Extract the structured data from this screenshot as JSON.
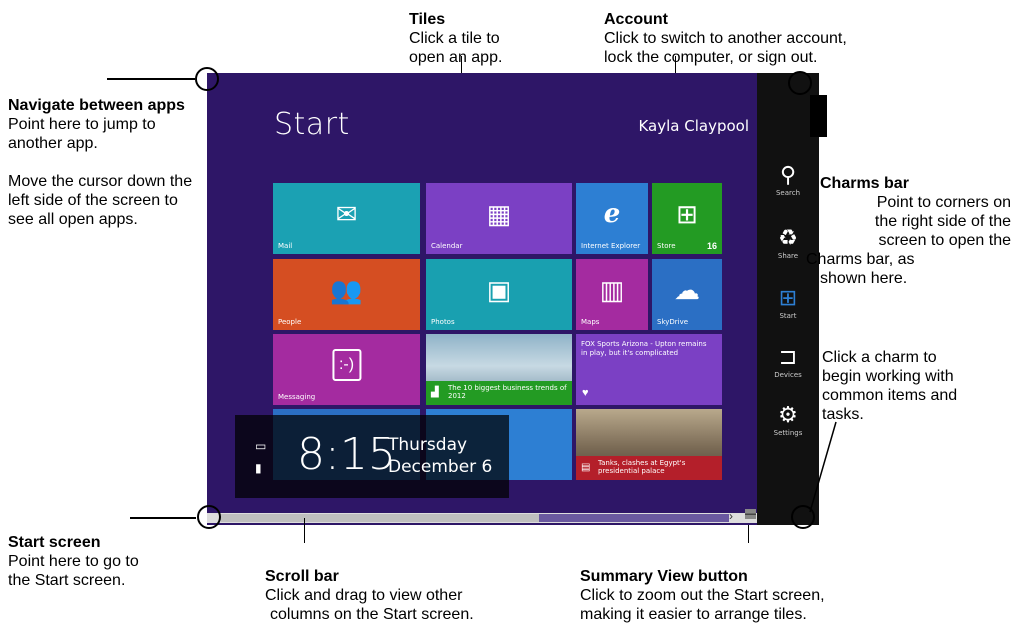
{
  "callouts": {
    "navigate": {
      "bold": "Navigate between apps",
      "text": "Point here to jump to another app.",
      "extra": "Move the cursor down the left side of the screen to see all open apps."
    },
    "tiles": {
      "title": "Tiles",
      "text1": "Click a tile to",
      "text2": "open an app."
    },
    "account": {
      "title": "Account",
      "text1": "Click to switch to another account,",
      "text2": "lock the computer, or sign out."
    },
    "charms_bar": {
      "title": "Charms bar",
      "text1": "Point to corners on",
      "text2": "the right side of the",
      "text3": "screen to open the",
      "text4": "Charms bar, as",
      "text5": "shown here."
    },
    "click_charm": {
      "text1": "Click a charm to",
      "text2": "begin working with",
      "text3": "common items and",
      "text4": "tasks."
    },
    "start_screen": {
      "title": "Start screen",
      "text1": "Point here to go to",
      "text2": "the Start screen."
    },
    "scroll_bar": {
      "title": "Scroll bar",
      "text1": "Click and drag to view other",
      "text2": "columns on the Start screen."
    },
    "summary_view": {
      "title": "Summary View button",
      "text1": "Click to zoom out the Start screen,",
      "text2": "making it easier to arrange tiles."
    }
  },
  "screen": {
    "title": "Start",
    "user": "Kayla Claypool",
    "clock": {
      "time": "8:15",
      "day": "Thursday",
      "date": "December 6"
    },
    "tiles": {
      "mail": {
        "label": "Mail",
        "color": "#1ba1b3"
      },
      "calendar": {
        "label": "Calendar",
        "color": "#7b40c4"
      },
      "ie": {
        "label": "Internet Explorer",
        "color": "#2d7fd3"
      },
      "store": {
        "label": "Store",
        "badge": "16",
        "color": "#239b23"
      },
      "people": {
        "label": "People",
        "color": "#d54e22"
      },
      "photos": {
        "label": "Photos",
        "color": "#19a0b0"
      },
      "maps": {
        "label": "Maps",
        "color": "#a42ba0"
      },
      "skydrive": {
        "label": "SkyDrive",
        "color": "#2b6fc4"
      },
      "messaging": {
        "label": "Messaging",
        "color": "#a42ba0"
      },
      "business": {
        "label": "The 10 biggest business trends of 2012",
        "color": "#239b23"
      },
      "sports": {
        "label": "FOX Sports Arizona - Upton remains in play, but it's complicated",
        "color": "#7b40c4"
      },
      "news": {
        "label": "Tanks, clashes at Egypt's presidential palace",
        "color": "#b41f2a"
      }
    }
  },
  "charms": [
    {
      "label": "Search",
      "icon": "search-icon"
    },
    {
      "label": "Share",
      "icon": "share-icon"
    },
    {
      "label": "Start",
      "icon": "windows-icon"
    },
    {
      "label": "Devices",
      "icon": "devices-icon"
    },
    {
      "label": "Settings",
      "icon": "gear-icon"
    }
  ],
  "summary_button_symbol": "—",
  "scroll_arrow": "›"
}
